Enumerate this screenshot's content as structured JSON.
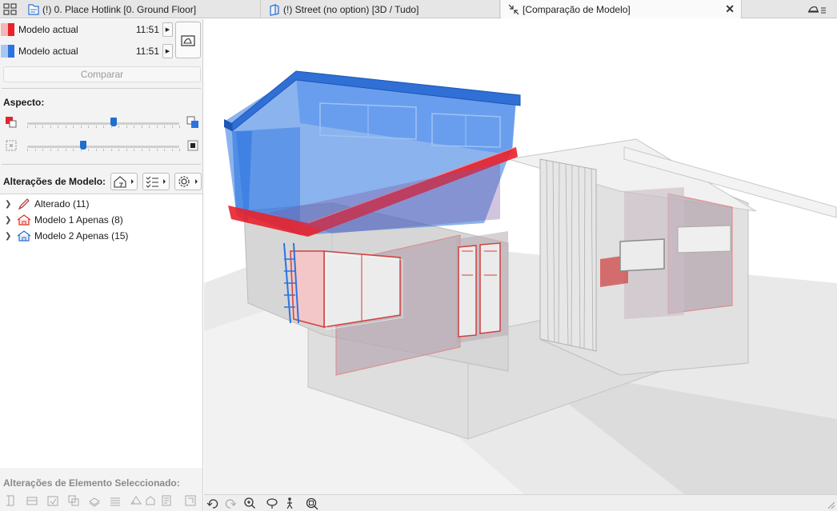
{
  "tabs": [
    {
      "label": "(!) 0. Place Hotlink [0. Ground Floor]",
      "icon": "floor-plan-icon"
    },
    {
      "label": "(!) Street (no option) [3D / Tudo]",
      "icon": "3d-window-icon"
    },
    {
      "label": "[Comparação de Modelo]",
      "icon": "compare-icon",
      "active": true
    }
  ],
  "models": [
    {
      "name": "Modelo actual",
      "time": "11:51",
      "color": "#e8212b"
    },
    {
      "name": "Modelo actual",
      "time": "11:51",
      "color": "#2b74e0"
    }
  ],
  "compare_label": "Comparar",
  "aspect": {
    "title": "Aspecto:",
    "slider_color": 0.57,
    "slider_opacity": 0.37
  },
  "changes": {
    "title": "Alterações de Modelo:",
    "items": [
      {
        "label": "Alterado (11)",
        "icon": "pencil-icon"
      },
      {
        "label": "Modelo 1 Apenas (8)",
        "icon": "house-red-icon"
      },
      {
        "label": "Modelo 2 Apenas (15)",
        "icon": "house-blue-icon"
      }
    ]
  },
  "selected_changes_title": "Alterações de Elemento Seleccionado:",
  "colors": {
    "red": "#e8212b",
    "blue": "#2b74e0",
    "accent": "#1e6fcf"
  }
}
